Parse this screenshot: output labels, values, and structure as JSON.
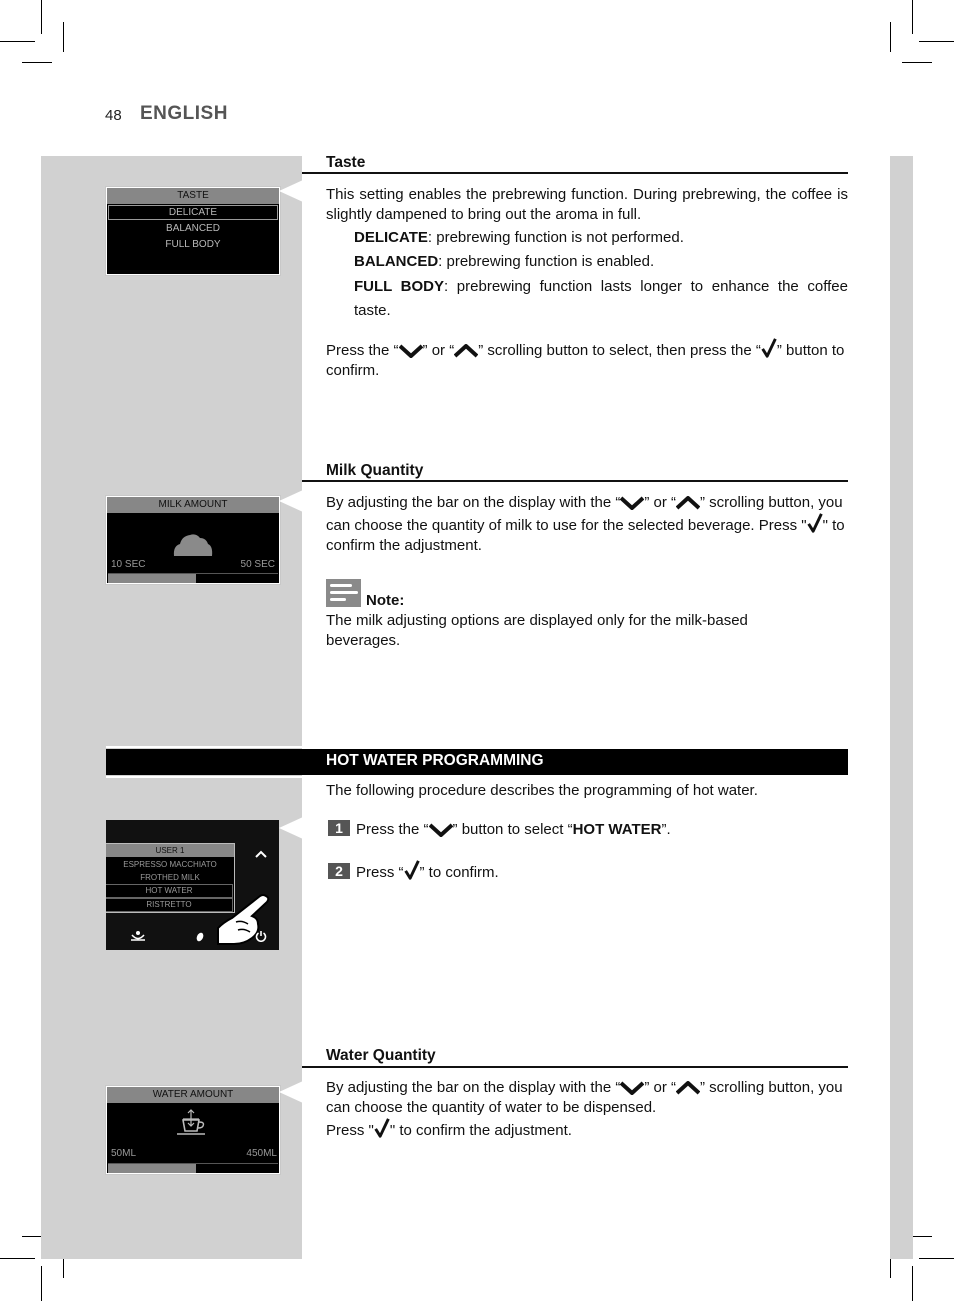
{
  "header": {
    "page_number": "48",
    "language": "ENGLISH"
  },
  "sections": {
    "taste": {
      "title": "Taste",
      "intro": "This setting enables the prebrewing function. During prebrewing, the coffee is slightly dampened to bring out the aroma in full.",
      "options": [
        {
          "term": "DELICATE",
          "desc": ": prebrewing function is not performed."
        },
        {
          "term": "BALANCED",
          "desc": ": prebrewing function is enabled."
        },
        {
          "term": "FULL BODY",
          "desc": ": prebrewing function lasts longer to enhance the coffee taste."
        }
      ],
      "instr_1": "Press the “",
      "instr_2": "” or “",
      "instr_3": "” scrolling button to select, then press the “",
      "instr_4": "” button to confirm.",
      "screen": {
        "header": "TASTE",
        "items": [
          "DELICATE",
          "BALANCED",
          "FULL BODY"
        ],
        "selected": "DELICATE"
      }
    },
    "milk": {
      "title": "Milk Quantity",
      "p1": "By adjusting the bar on the display with the “",
      "p2": "” or “",
      "p3": "” scrolling button, you can choose the quantity of milk to use for the selected beverage. Press \"",
      "p4": "\" to confirm the adjustment.",
      "note_label": "Note:",
      "note_text": "The milk adjusting options are displayed only for the milk-based beverages.",
      "screen": {
        "header": "MILK AMOUNT",
        "min_label": "10 SEC",
        "max_label": "50 SEC",
        "level_fraction": 0.52
      }
    },
    "hot_water": {
      "banner": "HOT WATER PROGRAMMING",
      "intro": "The following procedure describes the programming of hot water.",
      "step1_num": "1",
      "step1_a": "Press the “",
      "step1_b": "” button to select “",
      "step1_bold": "HOT WATER",
      "step1_c": "”.",
      "step2_num": "2",
      "step2_a": "Press “",
      "step2_b": "” to confirm.",
      "screen": {
        "header": "USER 1",
        "items": [
          "ESPRESSO MACCHIATO",
          "FROTHED MILK",
          "HOT WATER",
          "RISTRETTO"
        ],
        "highlighted": [
          "HOT WATER",
          "RISTRETTO"
        ]
      }
    },
    "water": {
      "title": "Water Quantity",
      "p1": "By adjusting the bar on the display with the “",
      "p2": "” or “",
      "p3": "” scrolling button, you can choose the quantity of water to be dispensed.",
      "p4": "Press \"",
      "p5": "\" to confirm the adjustment.",
      "screen": {
        "header": "WATER AMOUNT",
        "min_label": "50ML",
        "max_label": "450ML",
        "level_fraction": 0.52
      }
    }
  },
  "icons": {
    "down": "chevron-down-icon",
    "up": "chevron-up-icon",
    "confirm": "checkmark-icon"
  }
}
